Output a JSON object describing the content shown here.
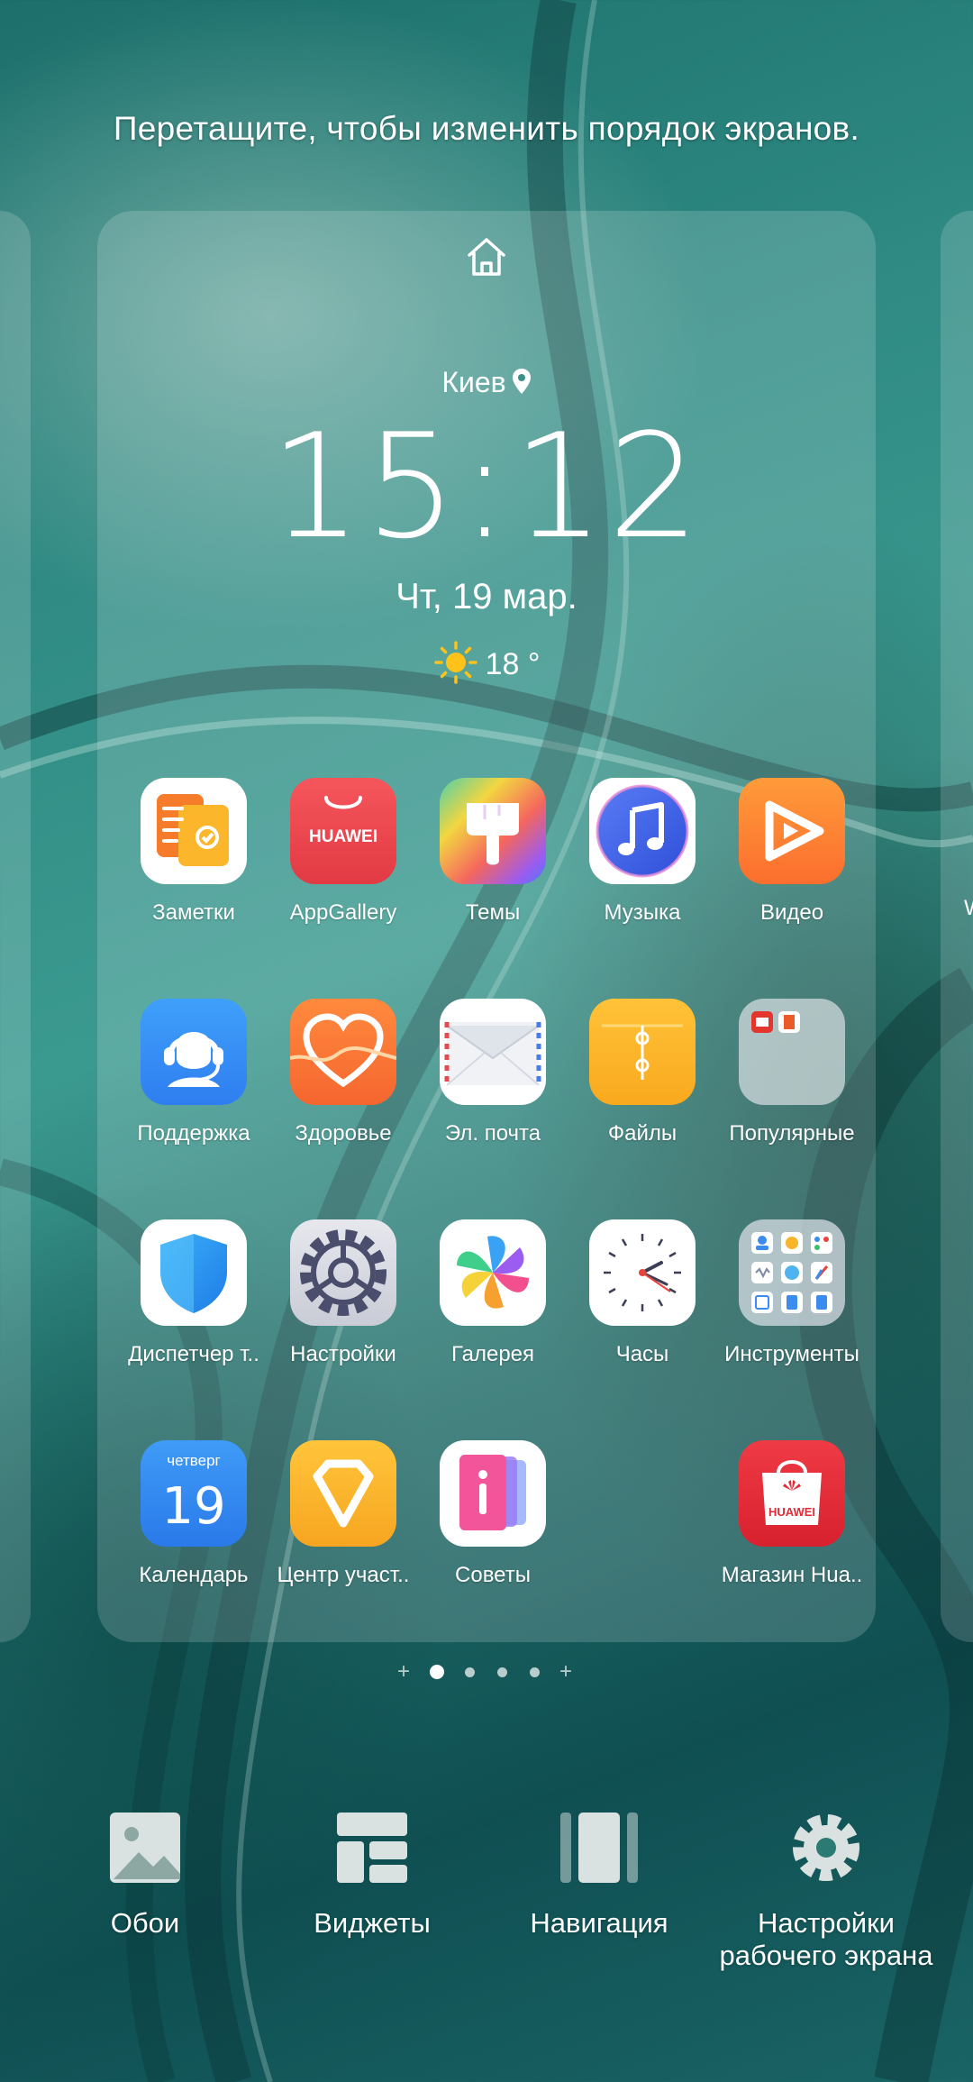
{
  "hint": "Перетащите, чтобы изменить порядок экранов.",
  "clock": {
    "city": "Киев",
    "time": "15:12",
    "date": "Чт, 19 мар.",
    "temperature": "18 °"
  },
  "apps": [
    {
      "label": "Заметки",
      "icon": "notes-icon"
    },
    {
      "label": "AppGallery",
      "icon": "appgallery-icon",
      "icon_text": "HUAWEI"
    },
    {
      "label": "Темы",
      "icon": "themes-brush-icon"
    },
    {
      "label": "Музыка",
      "icon": "music-note-icon"
    },
    {
      "label": "Видео",
      "icon": "video-play-icon"
    },
    {
      "label": "Поддержка",
      "icon": "support-headset-icon"
    },
    {
      "label": "Здоровье",
      "icon": "health-heart-icon"
    },
    {
      "label": "Эл. почта",
      "icon": "mail-envelope-icon"
    },
    {
      "label": "Файлы",
      "icon": "files-folder-icon"
    },
    {
      "label": "Популярные",
      "icon": "popular-folder-icon"
    },
    {
      "label": "Диспетчер т..",
      "icon": "shield-icon"
    },
    {
      "label": "Настройки",
      "icon": "settings-gear-icon"
    },
    {
      "label": "Галерея",
      "icon": "gallery-pinwheel-icon"
    },
    {
      "label": "Часы",
      "icon": "clock-icon"
    },
    {
      "label": "Инструменты",
      "icon": "tools-folder-icon"
    },
    {
      "label": "Календарь",
      "icon": "calendar-icon",
      "icon_weekday": "четверг",
      "icon_day": "19"
    },
    {
      "label": "Центр участ..",
      "icon": "member-center-diamond-icon"
    },
    {
      "label": "Советы",
      "icon": "tips-icon"
    },
    {
      "label": "Магазин Hua..",
      "icon": "huawei-store-bag-icon",
      "icon_text": "HUAWEI"
    }
  ],
  "side_right_label": "W",
  "page_indicator": {
    "pages": 4,
    "active": 0
  },
  "bottom_bar": [
    {
      "label": "Обои",
      "icon": "wallpaper-icon"
    },
    {
      "label": "Виджеты",
      "icon": "widgets-icon"
    },
    {
      "label": "Навигация",
      "icon": "navigation-icon"
    },
    {
      "label": "Настройки рабочего экрана",
      "icon": "home-settings-gear-icon"
    }
  ],
  "colors": {
    "wallpaper_dark": "#0f4f52",
    "wallpaper_mid": "#2f8b84",
    "panel": "rgba(255,255,255,0.17)"
  }
}
